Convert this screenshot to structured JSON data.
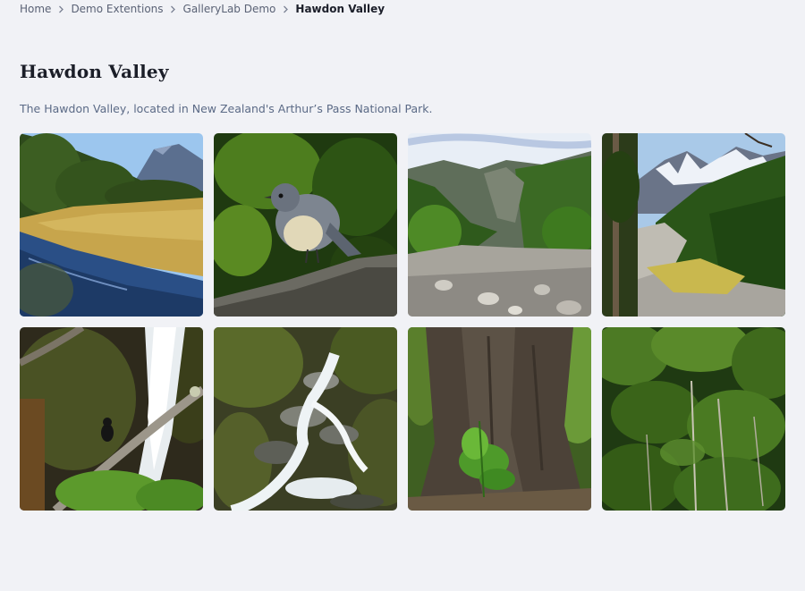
{
  "breadcrumb": {
    "items": [
      {
        "label": "Home",
        "current": false
      },
      {
        "label": "Demo Extentions",
        "current": false
      },
      {
        "label": "GalleryLab Demo",
        "current": false
      },
      {
        "label": "Hawdon Valley",
        "current": true
      }
    ]
  },
  "page": {
    "title": "Hawdon Valley",
    "description": "The Hawdon Valley, located in New Zealand's Arthur’s Pass National Park."
  },
  "gallery": {
    "images": [
      {
        "name": "meadow-river-mountain"
      },
      {
        "name": "robin-bird-on-branch"
      },
      {
        "name": "riverbed-valley-mountains"
      },
      {
        "name": "snowy-peaks-valley"
      },
      {
        "name": "waterfall-with-bird"
      },
      {
        "name": "cascading-stream"
      },
      {
        "name": "large-tree-trunk-fern"
      },
      {
        "name": "dense-beech-forest"
      }
    ]
  }
}
